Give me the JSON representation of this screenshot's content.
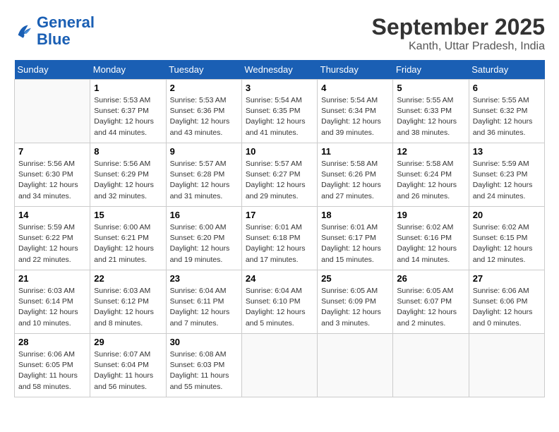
{
  "logo": {
    "line1": "General",
    "line2": "Blue"
  },
  "title": "September 2025",
  "subtitle": "Kanth, Uttar Pradesh, India",
  "weekdays": [
    "Sunday",
    "Monday",
    "Tuesday",
    "Wednesday",
    "Thursday",
    "Friday",
    "Saturday"
  ],
  "weeks": [
    [
      {
        "day": "",
        "info": ""
      },
      {
        "day": "1",
        "info": "Sunrise: 5:53 AM\nSunset: 6:37 PM\nDaylight: 12 hours\nand 44 minutes."
      },
      {
        "day": "2",
        "info": "Sunrise: 5:53 AM\nSunset: 6:36 PM\nDaylight: 12 hours\nand 43 minutes."
      },
      {
        "day": "3",
        "info": "Sunrise: 5:54 AM\nSunset: 6:35 PM\nDaylight: 12 hours\nand 41 minutes."
      },
      {
        "day": "4",
        "info": "Sunrise: 5:54 AM\nSunset: 6:34 PM\nDaylight: 12 hours\nand 39 minutes."
      },
      {
        "day": "5",
        "info": "Sunrise: 5:55 AM\nSunset: 6:33 PM\nDaylight: 12 hours\nand 38 minutes."
      },
      {
        "day": "6",
        "info": "Sunrise: 5:55 AM\nSunset: 6:32 PM\nDaylight: 12 hours\nand 36 minutes."
      }
    ],
    [
      {
        "day": "7",
        "info": "Sunrise: 5:56 AM\nSunset: 6:30 PM\nDaylight: 12 hours\nand 34 minutes."
      },
      {
        "day": "8",
        "info": "Sunrise: 5:56 AM\nSunset: 6:29 PM\nDaylight: 12 hours\nand 32 minutes."
      },
      {
        "day": "9",
        "info": "Sunrise: 5:57 AM\nSunset: 6:28 PM\nDaylight: 12 hours\nand 31 minutes."
      },
      {
        "day": "10",
        "info": "Sunrise: 5:57 AM\nSunset: 6:27 PM\nDaylight: 12 hours\nand 29 minutes."
      },
      {
        "day": "11",
        "info": "Sunrise: 5:58 AM\nSunset: 6:26 PM\nDaylight: 12 hours\nand 27 minutes."
      },
      {
        "day": "12",
        "info": "Sunrise: 5:58 AM\nSunset: 6:24 PM\nDaylight: 12 hours\nand 26 minutes."
      },
      {
        "day": "13",
        "info": "Sunrise: 5:59 AM\nSunset: 6:23 PM\nDaylight: 12 hours\nand 24 minutes."
      }
    ],
    [
      {
        "day": "14",
        "info": "Sunrise: 5:59 AM\nSunset: 6:22 PM\nDaylight: 12 hours\nand 22 minutes."
      },
      {
        "day": "15",
        "info": "Sunrise: 6:00 AM\nSunset: 6:21 PM\nDaylight: 12 hours\nand 21 minutes."
      },
      {
        "day": "16",
        "info": "Sunrise: 6:00 AM\nSunset: 6:20 PM\nDaylight: 12 hours\nand 19 minutes."
      },
      {
        "day": "17",
        "info": "Sunrise: 6:01 AM\nSunset: 6:18 PM\nDaylight: 12 hours\nand 17 minutes."
      },
      {
        "day": "18",
        "info": "Sunrise: 6:01 AM\nSunset: 6:17 PM\nDaylight: 12 hours\nand 15 minutes."
      },
      {
        "day": "19",
        "info": "Sunrise: 6:02 AM\nSunset: 6:16 PM\nDaylight: 12 hours\nand 14 minutes."
      },
      {
        "day": "20",
        "info": "Sunrise: 6:02 AM\nSunset: 6:15 PM\nDaylight: 12 hours\nand 12 minutes."
      }
    ],
    [
      {
        "day": "21",
        "info": "Sunrise: 6:03 AM\nSunset: 6:14 PM\nDaylight: 12 hours\nand 10 minutes."
      },
      {
        "day": "22",
        "info": "Sunrise: 6:03 AM\nSunset: 6:12 PM\nDaylight: 12 hours\nand 8 minutes."
      },
      {
        "day": "23",
        "info": "Sunrise: 6:04 AM\nSunset: 6:11 PM\nDaylight: 12 hours\nand 7 minutes."
      },
      {
        "day": "24",
        "info": "Sunrise: 6:04 AM\nSunset: 6:10 PM\nDaylight: 12 hours\nand 5 minutes."
      },
      {
        "day": "25",
        "info": "Sunrise: 6:05 AM\nSunset: 6:09 PM\nDaylight: 12 hours\nand 3 minutes."
      },
      {
        "day": "26",
        "info": "Sunrise: 6:05 AM\nSunset: 6:07 PM\nDaylight: 12 hours\nand 2 minutes."
      },
      {
        "day": "27",
        "info": "Sunrise: 6:06 AM\nSunset: 6:06 PM\nDaylight: 12 hours\nand 0 minutes."
      }
    ],
    [
      {
        "day": "28",
        "info": "Sunrise: 6:06 AM\nSunset: 6:05 PM\nDaylight: 11 hours\nand 58 minutes."
      },
      {
        "day": "29",
        "info": "Sunrise: 6:07 AM\nSunset: 6:04 PM\nDaylight: 11 hours\nand 56 minutes."
      },
      {
        "day": "30",
        "info": "Sunrise: 6:08 AM\nSunset: 6:03 PM\nDaylight: 11 hours\nand 55 minutes."
      },
      {
        "day": "",
        "info": ""
      },
      {
        "day": "",
        "info": ""
      },
      {
        "day": "",
        "info": ""
      },
      {
        "day": "",
        "info": ""
      }
    ]
  ]
}
